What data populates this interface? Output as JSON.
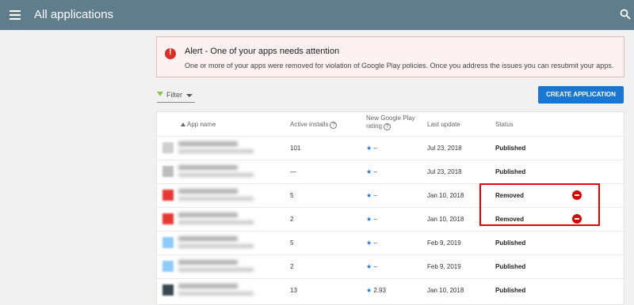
{
  "header": {
    "title": "All applications"
  },
  "alert": {
    "title": "Alert - One of your apps needs attention",
    "text": "One or more of your apps were removed for violation of Google Play policies. Once you address the issues you can resubmit your apps."
  },
  "toolbar": {
    "filter_label": "Filter",
    "create_label": "CREATE APPLICATION"
  },
  "table": {
    "columns": {
      "app_name": "App name",
      "active_installs": "Active installs",
      "rating_line1": "New Google Play",
      "rating_line2": "rating",
      "last_update": "Last update",
      "status": "Status"
    },
    "rows": [
      {
        "installs": "101",
        "rating": "–",
        "last_update": "Jul 23, 2018",
        "status": "Published"
      },
      {
        "installs": "—",
        "rating": "–",
        "last_update": "Jul 23, 2018",
        "status": "Published"
      },
      {
        "installs": "5",
        "rating": "–",
        "last_update": "Jan 10, 2018",
        "status": "Removed"
      },
      {
        "installs": "2",
        "rating": "–",
        "last_update": "Jan 10, 2018",
        "status": "Removed"
      },
      {
        "installs": "5",
        "rating": "–",
        "last_update": "Feb 9, 2019",
        "status": "Published"
      },
      {
        "installs": "2",
        "rating": "–",
        "last_update": "Feb 9, 2019",
        "status": "Published"
      },
      {
        "installs": "13",
        "rating": "2.93",
        "last_update": "Jan 10, 2018",
        "status": "Published"
      }
    ]
  },
  "colors": {
    "topbar": "#607d8b",
    "primary": "#1976d2",
    "removed": "#d50000",
    "alert": "#d93025"
  },
  "icons": [
    "menu-icon",
    "search-icon",
    "alert-icon",
    "filter-icon",
    "help-icon",
    "star-icon",
    "removed-icon"
  ]
}
